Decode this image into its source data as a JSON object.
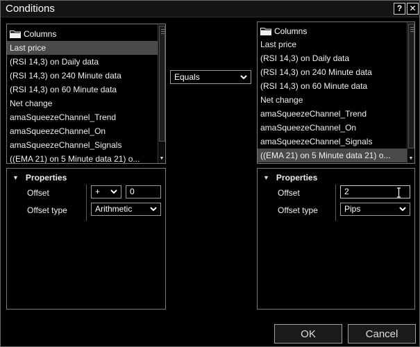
{
  "window": {
    "title": "Conditions",
    "help_label": "?",
    "close_label": "✕"
  },
  "left_list": {
    "header": "Columns",
    "items": [
      "Last price",
      "(RSI 14,3) on Daily data",
      "(RSI 14,3) on 240 Minute data",
      "(RSI 14,3) on 60 Minute data",
      "Net change",
      "amaSqueezeChannel_Trend",
      "amaSqueezeChannel_On",
      "amaSqueezeChannel_Signals",
      "((EMA 21) on 5 Minute data 21) o..."
    ],
    "selected_index": 0
  },
  "right_list": {
    "header": "Columns",
    "items": [
      "Last price",
      "(RSI 14,3) on Daily data",
      "(RSI 14,3) on 240 Minute data",
      "(RSI 14,3) on 60 Minute data",
      "Net change",
      "amaSqueezeChannel_Trend",
      "amaSqueezeChannel_On",
      "amaSqueezeChannel_Signals",
      "((EMA 21) on 5 Minute data 21) o..."
    ],
    "selected_index": 8
  },
  "operator": {
    "value": "Equals"
  },
  "left_props": {
    "header": "Properties",
    "offset_label": "Offset",
    "offset_type_label": "Offset type",
    "sign_value": "+",
    "offset_value": "0",
    "offset_type_value": "Arithmetic"
  },
  "right_props": {
    "header": "Properties",
    "offset_label": "Offset",
    "offset_type_label": "Offset type",
    "offset_value": "2",
    "offset_type_value": "Pips"
  },
  "buttons": {
    "ok": "OK",
    "cancel": "Cancel"
  },
  "colors": {
    "background": "#000000",
    "border": "#7a7a7a",
    "selected_row": "#4a4a4a",
    "text": "#f0f0f0"
  }
}
